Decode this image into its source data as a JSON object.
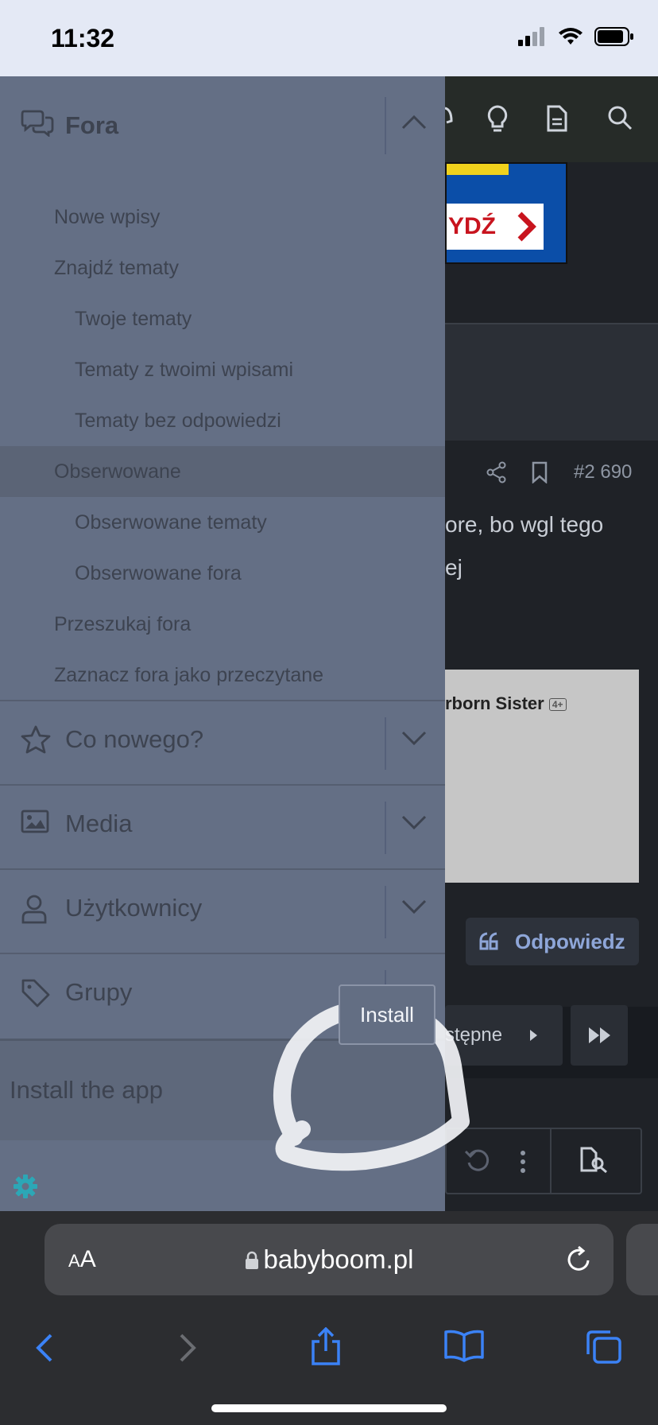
{
  "status_bar": {
    "time": "11:32"
  },
  "background_page": {
    "ad_button": "YDŹ",
    "post_number": "#2 690",
    "post_text_line1": "ore, bo wgl tego",
    "post_text_line2": "ej",
    "card_title": "rborn Sister",
    "card_badge": "4+",
    "reply_label": "Odpowiedz",
    "next_label": "stępne"
  },
  "drawer": {
    "fora": {
      "label": "Fora",
      "items": [
        {
          "label": "Nowe wpisy",
          "level": 1
        },
        {
          "label": "Znajdź tematy",
          "level": 1
        },
        {
          "label": "Twoje tematy",
          "level": 2
        },
        {
          "label": "Tematy z twoimi wpisami",
          "level": 2
        },
        {
          "label": "Tematy bez odpowiedzi",
          "level": 2
        },
        {
          "label": "Obserwowane",
          "level": 1
        },
        {
          "label": "Obserwowane tematy",
          "level": 2
        },
        {
          "label": "Obserwowane fora",
          "level": 2
        },
        {
          "label": "Przeszukaj fora",
          "level": 1
        },
        {
          "label": "Zaznacz fora jako przeczytane",
          "level": 1
        }
      ]
    },
    "sections": [
      {
        "label": "Co nowego?",
        "icon": "star-icon"
      },
      {
        "label": "Media",
        "icon": "image-icon"
      },
      {
        "label": "Użytkownicy",
        "icon": "user-icon"
      },
      {
        "label": "Grupy",
        "icon": "tag-icon"
      }
    ],
    "install_label": "Install the app",
    "install_button": "Install"
  },
  "safari": {
    "text_size_label_small": "A",
    "text_size_label_large": "A",
    "url": "babyboom.pl"
  },
  "colors": {
    "drawer_bg": "#646f85",
    "accent_teal": "#2ca7b6",
    "ios_blue": "#3b82f6"
  }
}
